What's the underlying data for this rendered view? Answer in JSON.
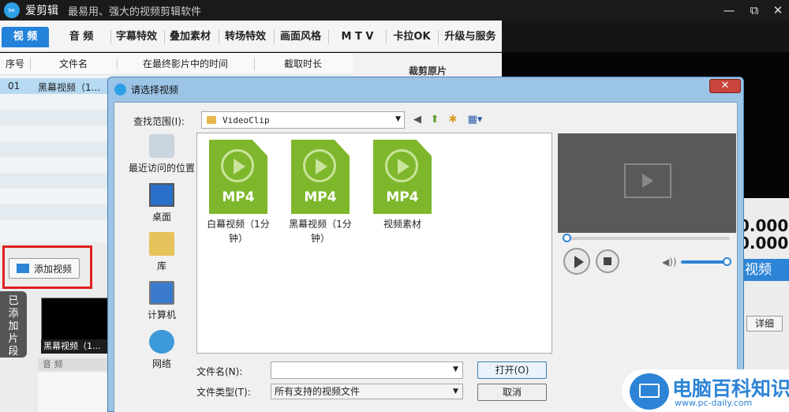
{
  "app": {
    "name": "爱剪辑",
    "slogan": "最易用、强大的视频剪辑软件",
    "logo_icon": "film-reel-icon"
  },
  "window_controls": {
    "minimize": "—",
    "maximize": "⧉",
    "close": "✕"
  },
  "tabs": [
    "视 频",
    "音 频",
    "字幕特效",
    "叠加素材",
    "转场特效",
    "画面风格",
    "M T V",
    "卡拉OK",
    "升级与服务"
  ],
  "list": {
    "headers": [
      "序号",
      "文件名",
      "在最终影片中的时间",
      "截取时长"
    ],
    "rows": [
      {
        "no": "01",
        "name": "黑幕视频（1..."
      }
    ]
  },
  "cut_panel": {
    "title": "裁剪原片"
  },
  "add_video_button": "添加视频",
  "side_tab": "已添加片段",
  "clip": {
    "label": "黑幕视频（1..."
  },
  "audio_row": "音 频",
  "right_panel": {
    "time1": "0.000",
    "time2": "0.000",
    "video_button": "视频",
    "detail_button": "详细"
  },
  "dialog": {
    "title": "请选择视频",
    "close": "✕",
    "look_in_label": "查找范围(I):",
    "look_in_value": "VideoClip",
    "toolbar_icons": [
      "back-icon",
      "up-folder-icon",
      "new-folder-icon",
      "view-menu-icon"
    ],
    "toolbar_glyphs": [
      "◀",
      "⬆",
      "✱",
      "▦▾"
    ],
    "places": [
      "最近访问的位置",
      "桌面",
      "库",
      "计算机",
      "网络"
    ],
    "files": [
      {
        "name": "白幕视频（1分钟）",
        "ext": "MP4"
      },
      {
        "name": "黑幕视频（1分钟）",
        "ext": "MP4"
      },
      {
        "name": "视频素材",
        "ext": "MP4"
      }
    ],
    "file_name_label": "文件名(N):",
    "file_name_value": "",
    "file_type_label": "文件类型(T):",
    "file_type_value": "所有支持的视频文件",
    "open_button": "打开(O)",
    "cancel_button": "取消",
    "volume_glyph": "◀))",
    "dropdown_glyph": "▼"
  },
  "watermark": {
    "text": "电脑百科知识",
    "url": "www.pc-daily.com"
  },
  "colors": {
    "accent": "#2382d9",
    "file_green": "#7fb72c",
    "highlight_red": "#e02020",
    "selection": "#b7daf3"
  }
}
